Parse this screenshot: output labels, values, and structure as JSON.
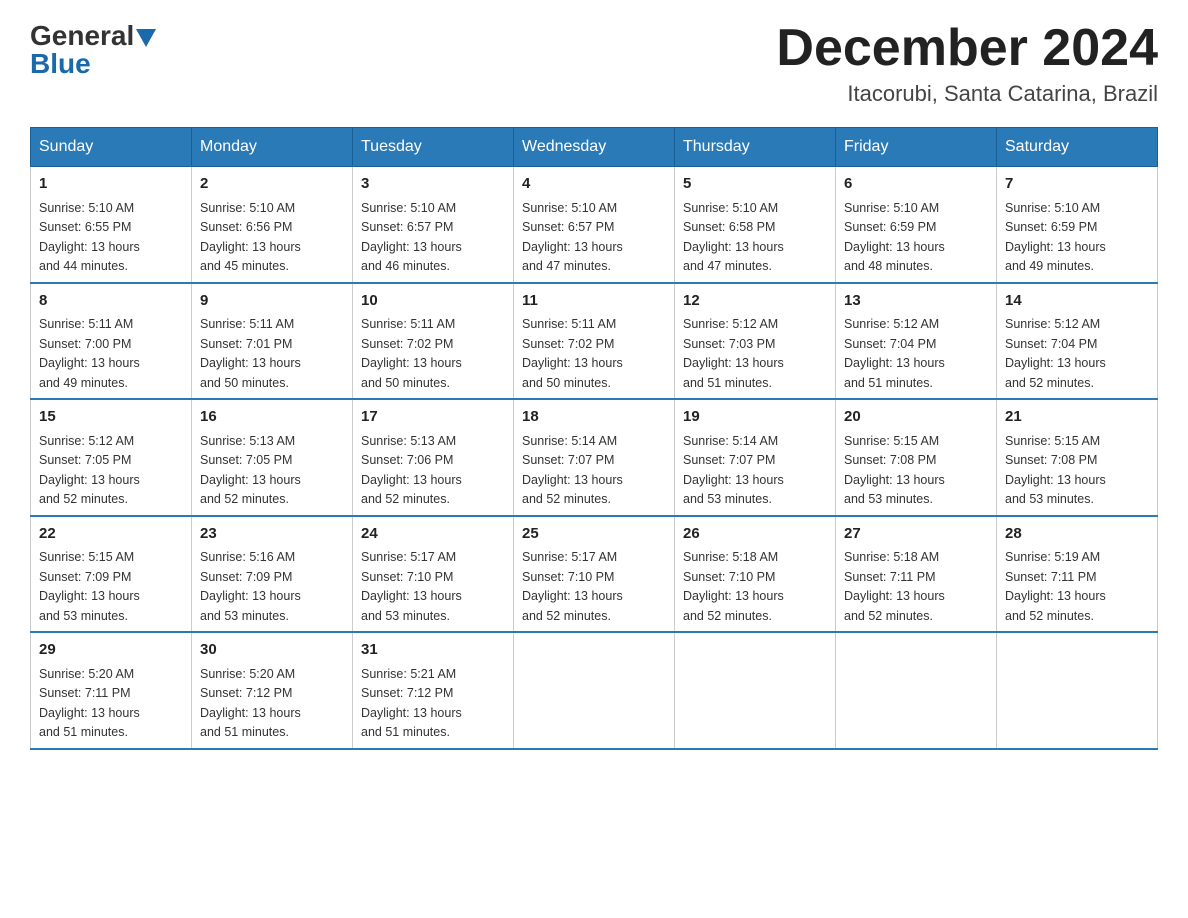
{
  "header": {
    "logo": {
      "general": "General",
      "blue": "Blue"
    },
    "title": "December 2024",
    "location": "Itacorubi, Santa Catarina, Brazil"
  },
  "weekdays": [
    "Sunday",
    "Monday",
    "Tuesday",
    "Wednesday",
    "Thursday",
    "Friday",
    "Saturday"
  ],
  "weeks": [
    [
      {
        "day": "1",
        "sunrise": "5:10 AM",
        "sunset": "6:55 PM",
        "daylight": "13 hours and 44 minutes."
      },
      {
        "day": "2",
        "sunrise": "5:10 AM",
        "sunset": "6:56 PM",
        "daylight": "13 hours and 45 minutes."
      },
      {
        "day": "3",
        "sunrise": "5:10 AM",
        "sunset": "6:57 PM",
        "daylight": "13 hours and 46 minutes."
      },
      {
        "day": "4",
        "sunrise": "5:10 AM",
        "sunset": "6:57 PM",
        "daylight": "13 hours and 47 minutes."
      },
      {
        "day": "5",
        "sunrise": "5:10 AM",
        "sunset": "6:58 PM",
        "daylight": "13 hours and 47 minutes."
      },
      {
        "day": "6",
        "sunrise": "5:10 AM",
        "sunset": "6:59 PM",
        "daylight": "13 hours and 48 minutes."
      },
      {
        "day": "7",
        "sunrise": "5:10 AM",
        "sunset": "6:59 PM",
        "daylight": "13 hours and 49 minutes."
      }
    ],
    [
      {
        "day": "8",
        "sunrise": "5:11 AM",
        "sunset": "7:00 PM",
        "daylight": "13 hours and 49 minutes."
      },
      {
        "day": "9",
        "sunrise": "5:11 AM",
        "sunset": "7:01 PM",
        "daylight": "13 hours and 50 minutes."
      },
      {
        "day": "10",
        "sunrise": "5:11 AM",
        "sunset": "7:02 PM",
        "daylight": "13 hours and 50 minutes."
      },
      {
        "day": "11",
        "sunrise": "5:11 AM",
        "sunset": "7:02 PM",
        "daylight": "13 hours and 50 minutes."
      },
      {
        "day": "12",
        "sunrise": "5:12 AM",
        "sunset": "7:03 PM",
        "daylight": "13 hours and 51 minutes."
      },
      {
        "day": "13",
        "sunrise": "5:12 AM",
        "sunset": "7:04 PM",
        "daylight": "13 hours and 51 minutes."
      },
      {
        "day": "14",
        "sunrise": "5:12 AM",
        "sunset": "7:04 PM",
        "daylight": "13 hours and 52 minutes."
      }
    ],
    [
      {
        "day": "15",
        "sunrise": "5:12 AM",
        "sunset": "7:05 PM",
        "daylight": "13 hours and 52 minutes."
      },
      {
        "day": "16",
        "sunrise": "5:13 AM",
        "sunset": "7:05 PM",
        "daylight": "13 hours and 52 minutes."
      },
      {
        "day": "17",
        "sunrise": "5:13 AM",
        "sunset": "7:06 PM",
        "daylight": "13 hours and 52 minutes."
      },
      {
        "day": "18",
        "sunrise": "5:14 AM",
        "sunset": "7:07 PM",
        "daylight": "13 hours and 52 minutes."
      },
      {
        "day": "19",
        "sunrise": "5:14 AM",
        "sunset": "7:07 PM",
        "daylight": "13 hours and 53 minutes."
      },
      {
        "day": "20",
        "sunrise": "5:15 AM",
        "sunset": "7:08 PM",
        "daylight": "13 hours and 53 minutes."
      },
      {
        "day": "21",
        "sunrise": "5:15 AM",
        "sunset": "7:08 PM",
        "daylight": "13 hours and 53 minutes."
      }
    ],
    [
      {
        "day": "22",
        "sunrise": "5:15 AM",
        "sunset": "7:09 PM",
        "daylight": "13 hours and 53 minutes."
      },
      {
        "day": "23",
        "sunrise": "5:16 AM",
        "sunset": "7:09 PM",
        "daylight": "13 hours and 53 minutes."
      },
      {
        "day": "24",
        "sunrise": "5:17 AM",
        "sunset": "7:10 PM",
        "daylight": "13 hours and 53 minutes."
      },
      {
        "day": "25",
        "sunrise": "5:17 AM",
        "sunset": "7:10 PM",
        "daylight": "13 hours and 52 minutes."
      },
      {
        "day": "26",
        "sunrise": "5:18 AM",
        "sunset": "7:10 PM",
        "daylight": "13 hours and 52 minutes."
      },
      {
        "day": "27",
        "sunrise": "5:18 AM",
        "sunset": "7:11 PM",
        "daylight": "13 hours and 52 minutes."
      },
      {
        "day": "28",
        "sunrise": "5:19 AM",
        "sunset": "7:11 PM",
        "daylight": "13 hours and 52 minutes."
      }
    ],
    [
      {
        "day": "29",
        "sunrise": "5:20 AM",
        "sunset": "7:11 PM",
        "daylight": "13 hours and 51 minutes."
      },
      {
        "day": "30",
        "sunrise": "5:20 AM",
        "sunset": "7:12 PM",
        "daylight": "13 hours and 51 minutes."
      },
      {
        "day": "31",
        "sunrise": "5:21 AM",
        "sunset": "7:12 PM",
        "daylight": "13 hours and 51 minutes."
      },
      null,
      null,
      null,
      null
    ]
  ],
  "labels": {
    "sunrise": "Sunrise:",
    "sunset": "Sunset:",
    "daylight": "Daylight:"
  }
}
